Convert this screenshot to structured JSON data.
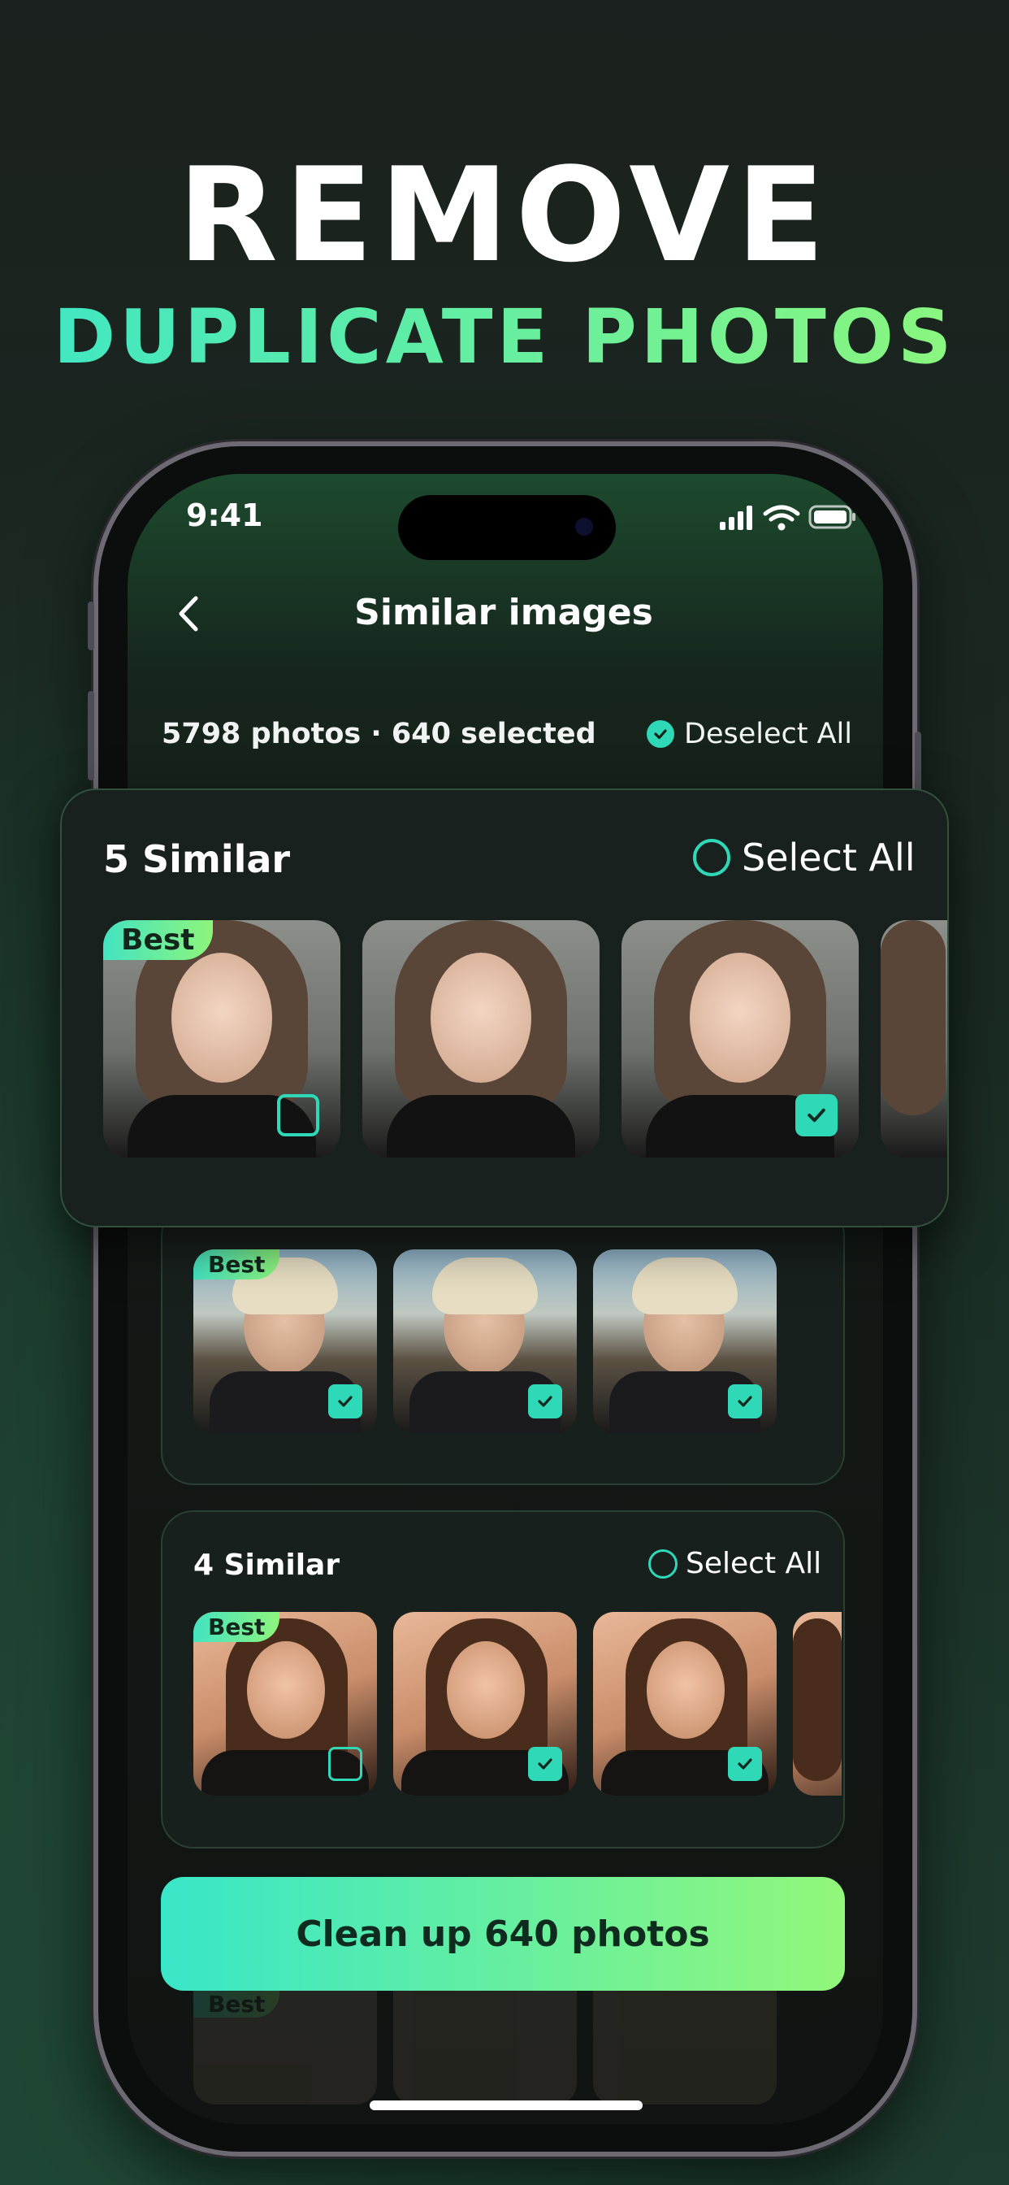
{
  "headline": {
    "line1": "REMOVE",
    "line2": "DUPLICATE PHOTOS"
  },
  "status_bar": {
    "time": "9:41"
  },
  "nav": {
    "title": "Similar images"
  },
  "summary": {
    "text": "5798 photos · 640 selected",
    "deselect_label": "Deselect All"
  },
  "groups": [
    {
      "title": "5 Similar",
      "select_all": "Select All",
      "best_label": "Best",
      "checks": [
        false,
        false,
        true
      ]
    },
    {
      "title": "",
      "best_label": "Best",
      "checks": [
        true,
        true,
        true
      ]
    },
    {
      "title": "4 Similar",
      "select_all": "Select All",
      "best_label": "Best",
      "checks": [
        false,
        true,
        true
      ]
    }
  ],
  "fade_row": {
    "best_label": "Best"
  },
  "cleanup_button": {
    "label": "Clean up 640 photos"
  },
  "colors": {
    "accent": "#2fd8b6",
    "accent_end": "#8ef57c",
    "card": "#18201d"
  }
}
